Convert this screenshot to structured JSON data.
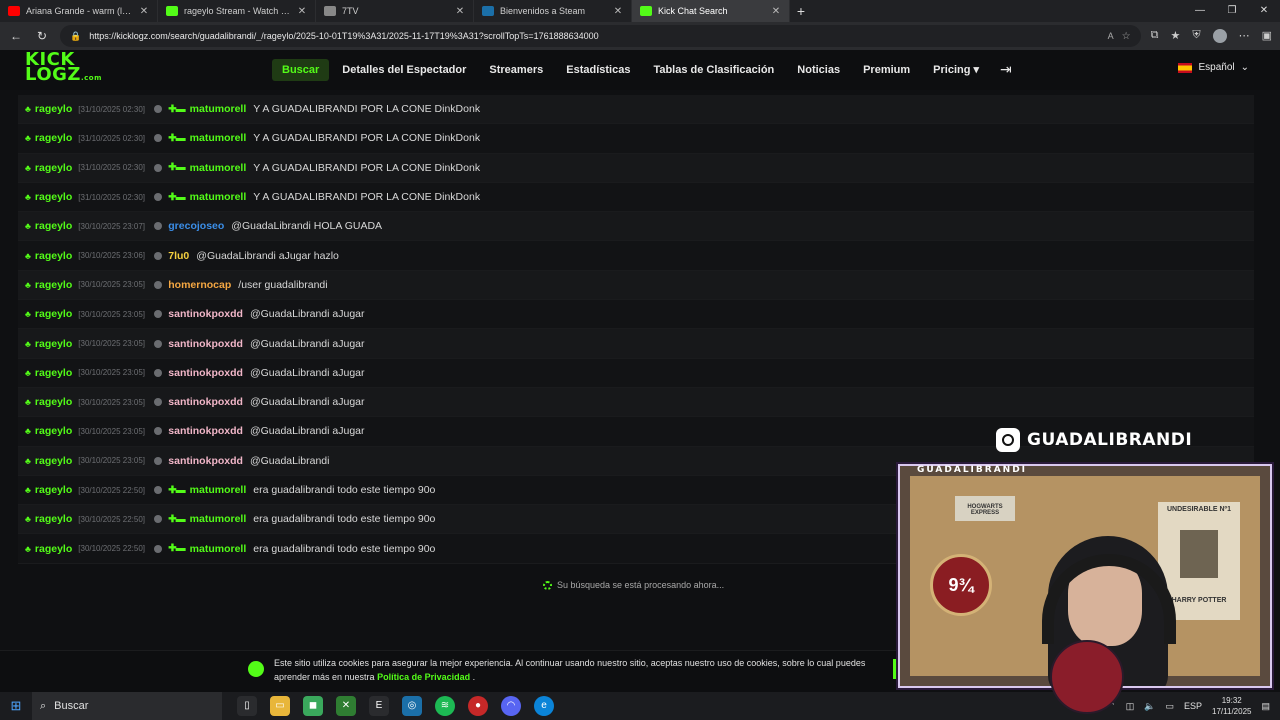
{
  "browser": {
    "tabs": [
      {
        "title": "Ariana Grande - warm (lyric",
        "color": "#ff0000",
        "active": false
      },
      {
        "title": "rageylo Stream - Watch Live",
        "color": "#53fc18",
        "active": false
      },
      {
        "title": "7TV",
        "color": "#888888",
        "active": false
      },
      {
        "title": "Bienvenidos a Steam",
        "color": "#1b6fa8",
        "active": false
      },
      {
        "title": "Kick Chat Search",
        "color": "#53fc18",
        "active": true
      }
    ],
    "url": "https://kicklogz.com/search/guadalibrandi/_/rageylo/2025-10-01T19%3A31/2025-11-17T19%3A31?scrollTopTs=1761888634000"
  },
  "site": {
    "logo_line1": "KICK",
    "logo_line2": "LOGZ",
    "logo_domain": ".com",
    "nav": [
      {
        "label": "Buscar",
        "active": true
      },
      {
        "label": "Detalles del Espectador",
        "active": false
      },
      {
        "label": "Streamers",
        "active": false
      },
      {
        "label": "Estadísticas",
        "active": false
      },
      {
        "label": "Tablas de Clasificación",
        "active": false
      },
      {
        "label": "Noticias",
        "active": false
      },
      {
        "label": "Premium",
        "active": false
      },
      {
        "label": "Pricing ▾",
        "active": false
      }
    ],
    "language": "Español"
  },
  "chat_rows": [
    {
      "channel": "rageylo",
      "time": "[31/10/2025 02:30]",
      "badge": true,
      "user": "matumorell",
      "user_color": "#53fc18",
      "message": "Y A GUADALIBRANDI POR LA CONE DinkDonk"
    },
    {
      "channel": "rageylo",
      "time": "[31/10/2025 02:30]",
      "badge": true,
      "user": "matumorell",
      "user_color": "#53fc18",
      "message": "Y A GUADALIBRANDI POR LA CONE DinkDonk"
    },
    {
      "channel": "rageylo",
      "time": "[31/10/2025 02:30]",
      "badge": true,
      "user": "matumorell",
      "user_color": "#53fc18",
      "message": "Y A GUADALIBRANDI POR LA CONE DinkDonk"
    },
    {
      "channel": "rageylo",
      "time": "[31/10/2025 02:30]",
      "badge": true,
      "user": "matumorell",
      "user_color": "#53fc18",
      "message": "Y A GUADALIBRANDI POR LA CONE DinkDonk"
    },
    {
      "channel": "rageylo",
      "time": "[30/10/2025 23:07]",
      "badge": false,
      "user": "grecojoseo",
      "user_color": "#3b8ee8",
      "message": "@GuadaLibrandi HOLA GUADA"
    },
    {
      "channel": "rageylo",
      "time": "[30/10/2025 23:06]",
      "badge": false,
      "user": "7lu0",
      "user_color": "#f4d03f",
      "message": "@GuadaLibrandi aJugar hazlo"
    },
    {
      "channel": "rageylo",
      "time": "[30/10/2025 23:05]",
      "badge": false,
      "user": "homernocap",
      "user_color": "#f5a742",
      "message": "/user guadalibrandi"
    },
    {
      "channel": "rageylo",
      "time": "[30/10/2025 23:05]",
      "badge": false,
      "user": "santinokpoxdd",
      "user_color": "#f1b6c8",
      "message": "@GuadaLibrandi aJugar"
    },
    {
      "channel": "rageylo",
      "time": "[30/10/2025 23:05]",
      "badge": false,
      "user": "santinokpoxdd",
      "user_color": "#f1b6c8",
      "message": "@GuadaLibrandi aJugar"
    },
    {
      "channel": "rageylo",
      "time": "[30/10/2025 23:05]",
      "badge": false,
      "user": "santinokpoxdd",
      "user_color": "#f1b6c8",
      "message": "@GuadaLibrandi aJugar"
    },
    {
      "channel": "rageylo",
      "time": "[30/10/2025 23:05]",
      "badge": false,
      "user": "santinokpoxdd",
      "user_color": "#f1b6c8",
      "message": "@GuadaLibrandi aJugar"
    },
    {
      "channel": "rageylo",
      "time": "[30/10/2025 23:05]",
      "badge": false,
      "user": "santinokpoxdd",
      "user_color": "#f1b6c8",
      "message": "@GuadaLibrandi aJugar"
    },
    {
      "channel": "rageylo",
      "time": "[30/10/2025 23:05]",
      "badge": false,
      "user": "santinokpoxdd",
      "user_color": "#f1b6c8",
      "message": "@GuadaLibrandi"
    },
    {
      "channel": "rageylo",
      "time": "[30/10/2025 22:50]",
      "badge": true,
      "user": "matumorell",
      "user_color": "#53fc18",
      "message": "era guadalibrandi todo este tiempo 90o"
    },
    {
      "channel": "rageylo",
      "time": "[30/10/2025 22:50]",
      "badge": true,
      "user": "matumorell",
      "user_color": "#53fc18",
      "message": "era guadalibrandi todo este tiempo 90o"
    },
    {
      "channel": "rageylo",
      "time": "[30/10/2025 22:50]",
      "badge": true,
      "user": "matumorell",
      "user_color": "#53fc18",
      "message": "era guadalibrandi todo este tiempo 90o"
    }
  ],
  "processing_text": "Su búsqueda se está procesando ahora...",
  "cookie": {
    "text": "Este sitio utiliza cookies para asegurar la mejor experiencia. Al continuar usando nuestro sitio, aceptas nuestro uso de cookies, sobre lo cual puedes aprender más en nuestra",
    "link": "Política de Privacidad",
    "end": "."
  },
  "overlay": {
    "instagram_handle": "GUADALIBRANDI",
    "cam_label": "GUADALIBRANDI",
    "poster_platform": "9¾",
    "poster_wanted_top": "UNDESIRABLE Nº1",
    "poster_wanted_name": "HARRY POTTER",
    "poster_hogwarts": "HOGWARTS EXPRESS"
  },
  "taskbar": {
    "search_placeholder": "Buscar",
    "lang": "ESP",
    "time": "19:32",
    "date": "17/11/2025"
  },
  "colors": {
    "accent": "#53fc18",
    "background": "#0f1012"
  }
}
